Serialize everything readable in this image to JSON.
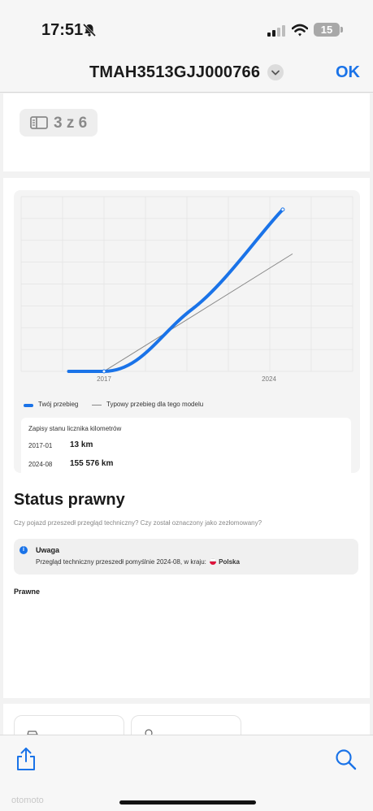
{
  "status_bar": {
    "time": "17:51",
    "battery_level": "15",
    "icons": [
      "bell-slash-icon",
      "cellular-signal-icon",
      "wifi-icon",
      "battery-icon"
    ]
  },
  "nav": {
    "title": "TMAH3513GJJ000766",
    "ok_label": "OK",
    "icons": [
      "chevron-down-icon"
    ]
  },
  "pager": {
    "label": "3 z 6",
    "icon": "sidebar-panel-icon"
  },
  "mileage_chart": {
    "legend": {
      "yours": "Twój przebieg",
      "typical": "Typowy przebieg dla tego modelu"
    },
    "colors": {
      "yours": "#1a73e8",
      "typical": "#888888"
    }
  },
  "chart_data": {
    "type": "line",
    "title": "",
    "xlabel": "",
    "ylabel": "",
    "x_ticks": [
      "2017",
      "2024"
    ],
    "grid": true,
    "legend_position": "bottom-left",
    "series": [
      {
        "name": "Twój przebieg",
        "x": [
          "2015-07",
          "2017-01",
          "2020-10",
          "2024-08"
        ],
        "y": [
          13,
          13,
          60000,
          155576
        ]
      },
      {
        "name": "Typowy przebieg dla tego modelu",
        "x": [
          "2017-01",
          "2025-01"
        ],
        "y": [
          13,
          113000
        ]
      }
    ]
  },
  "odometer": {
    "title": "Zapisy stanu licznika kilometrów",
    "records": [
      {
        "date": "2017-01",
        "value": "13 km"
      },
      {
        "date": "2024-08",
        "value": "155 576 km"
      }
    ]
  },
  "legal": {
    "title": "Status prawny",
    "subtitle": "Czy pojazd przeszedł przegląd techniczny? Czy został oznaczony jako zezłomowany?",
    "alert_title": "Uwaga",
    "alert_text": "Przegląd techniczny przeszedł pomyślnie 2024-08, w kraju:",
    "alert_country": "Polska",
    "alert_icon": "info-icon",
    "section_label": "Prawne"
  },
  "toolbar": {
    "icons": [
      "share-icon",
      "search-icon"
    ],
    "watermark": "otomoto"
  }
}
